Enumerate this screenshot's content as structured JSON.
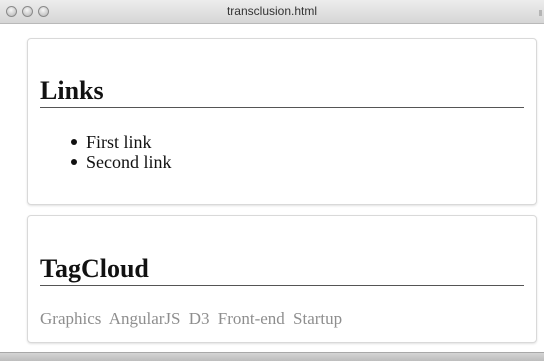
{
  "window": {
    "title": "transclusion.html"
  },
  "links_panel": {
    "heading": "Links",
    "items": [
      {
        "label": "First link"
      },
      {
        "label": "Second link"
      }
    ]
  },
  "tagcloud_panel": {
    "heading": "TagCloud",
    "tags": [
      "Graphics",
      "AngularJS",
      "D3",
      "Front-end",
      "Startup"
    ]
  },
  "colors": {
    "tag_text": "#8e8e8e",
    "heading_text": "#111111",
    "panel_border": "#d9d9d9"
  }
}
